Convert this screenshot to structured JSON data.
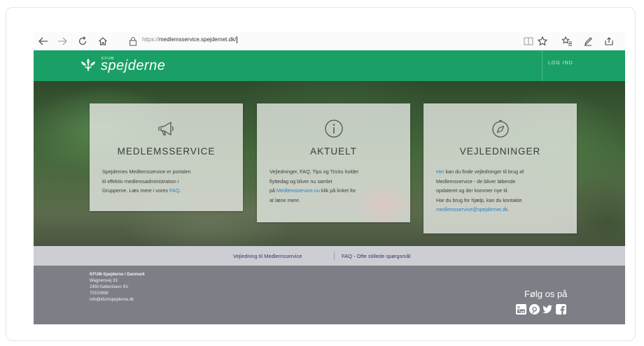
{
  "browser": {
    "url_protocol": "https://",
    "url_host": "medlemsservice.spejdernet.dk/",
    "icons": [
      "back-arrow-icon",
      "forward-arrow-icon",
      "refresh-icon",
      "home-icon",
      "lock-icon",
      "reading-view-icon",
      "favorite-star-icon",
      "favorites-hub-icon",
      "pen-icon",
      "share-icon"
    ]
  },
  "header": {
    "logo_small": "KFUM",
    "logo_text": "spejderne",
    "login_label": "LOG IND"
  },
  "cards": [
    {
      "icon": "megaphone-icon",
      "title": "MEDLEMSSERVICE",
      "body_1": "Spejdernes Medlemsservice er portalen",
      "body_2": "til effektiv medlemsadministration i",
      "body_3a": "Grupperne. Læs mere i vores ",
      "body_3_link": "FAQ",
      "body_3b": "."
    },
    {
      "icon": "info-icon",
      "title": "AKTUELT",
      "body_1": "Vejledninger, FAQ, Tips og Tricks holder",
      "body_2": "flyttedag og bliver nu samlet",
      "body_3a": "på ",
      "body_3_link": "Medlemsservice.nu",
      "body_3b": " klik på linket for",
      "body_4": "at læse mere."
    },
    {
      "icon": "compass-icon",
      "title": "VEJLEDNINGER",
      "body_1_link": "Her",
      "body_1b": " kan du finde vejledninger til brug af",
      "body_2": "Medlemsservice - de bliver løbende",
      "body_3": "opdateret og der kommer nye til.",
      "body_4": "Har du brug for hjælp, kan du kontakte",
      "body_5_link": "medlemsservice@spejdernet.dk",
      "body_5b": "."
    }
  ],
  "linkbar": {
    "link_1": "Vejledning til Medlemsservice",
    "link_2": "FAQ - Ofte stillede spørgsmål"
  },
  "footer": {
    "org": "KFUM-Spejderne i Danmark",
    "street": "Wagnersvej 33",
    "city": "2450 København SV",
    "phone": "70102698",
    "email": "info@kfumspejderne.dk",
    "follow_label": "Følg os på",
    "social_icons": [
      "youtube-icon",
      "pinterest-icon",
      "twitter-icon",
      "facebook-icon"
    ]
  },
  "colors": {
    "header_green": "#1aa066",
    "link_blue": "#2e7fc2",
    "footer_gray": "#7c7f86",
    "linkbar_gray": "#ccced4"
  }
}
